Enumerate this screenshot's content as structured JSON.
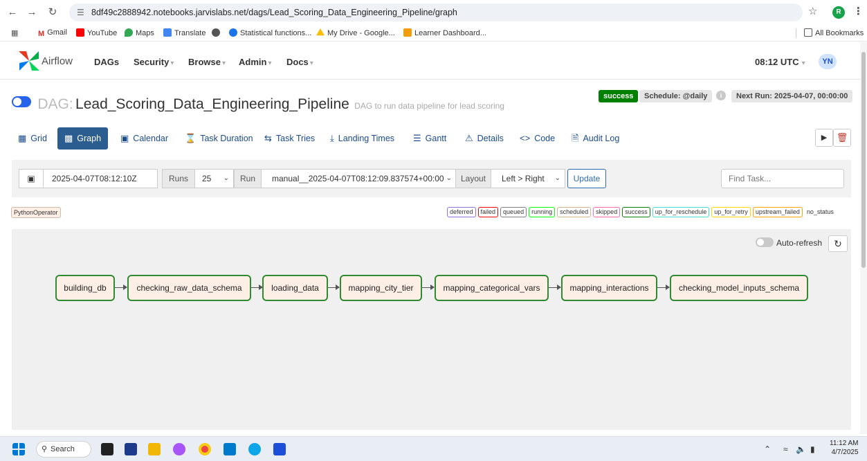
{
  "browser": {
    "url": "8df49c2888942.notebooks.jarvislabs.net/dags/Lead_Scoring_Data_Engineering_Pipeline/graph",
    "profile_initial": "R",
    "bookmarks": [
      "Gmail",
      "YouTube",
      "Maps",
      "Translate",
      "Statistical functions...",
      "My Drive - Google...",
      "Learner Dashboard..."
    ],
    "all_bookmarks": "All Bookmarks"
  },
  "nav": {
    "brand": "Airflow",
    "menu": [
      "DAGs",
      "Security",
      "Browse",
      "Admin",
      "Docs"
    ],
    "clock": "08:12 UTC",
    "user": "YN"
  },
  "dag": {
    "prefix": "DAG:",
    "name": "Lead_Scoring_Data_Engineering_Pipeline",
    "description": "DAG to run data pipeline for lead scoring",
    "status": "success",
    "schedule": "Schedule: @daily",
    "next_run": "Next Run: 2025-04-07, 00:00:00"
  },
  "tabs": [
    "Grid",
    "Graph",
    "Calendar",
    "Task Duration",
    "Task Tries",
    "Landing Times",
    "Gantt",
    "Details",
    "Code",
    "Audit Log"
  ],
  "controls": {
    "date": "2025-04-07T08:12:10Z",
    "runs_label": "Runs",
    "runs_value": "25",
    "run_label": "Run",
    "run_value": "manual__2025-04-07T08:12:09.837574+00:00",
    "layout_label": "Layout",
    "layout_value": "Left > Right",
    "update": "Update",
    "find_placeholder": "Find Task..."
  },
  "legend": {
    "operator": "PythonOperator",
    "states": [
      "deferred",
      "failed",
      "queued",
      "running",
      "scheduled",
      "skipped",
      "success",
      "up_for_reschedule",
      "up_for_retry",
      "upstream_failed",
      "no_status"
    ]
  },
  "graph": {
    "auto_refresh": "Auto-refresh",
    "tasks": [
      "building_db",
      "checking_raw_data_schema",
      "loading_data",
      "mapping_city_tier",
      "mapping_categorical_vars",
      "mapping_interactions",
      "checking_model_inputs_schema"
    ]
  },
  "taskbar": {
    "search": "Search",
    "time": "11:12 AM",
    "date": "4/7/2025"
  },
  "colors": {
    "success": "#008000",
    "task_fill": "#fdeee6",
    "task_border": "#2f8a31",
    "active_tab": "#2b5d91"
  }
}
